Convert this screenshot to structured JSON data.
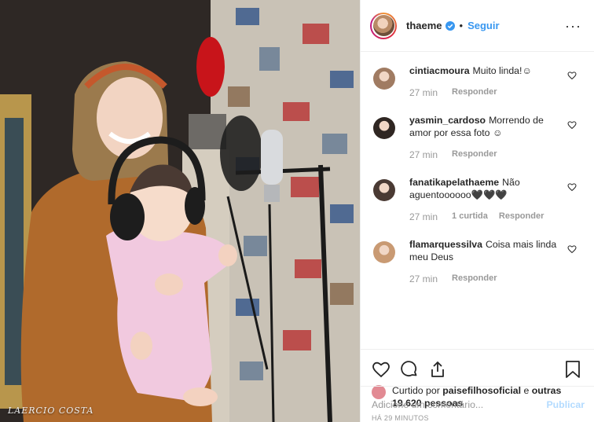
{
  "photo": {
    "watermark": "LAERCIO COSTA"
  },
  "header": {
    "username": "thaeme",
    "verified_icon": "verified-badge-icon",
    "separator": "•",
    "follow_label": "Seguir",
    "more_icon": "more-options-icon",
    "more_glyph": "···"
  },
  "comments": [
    {
      "user": "cintiacmoura",
      "text": "Muito linda!☺",
      "time": "27 min",
      "actions": [
        "Responder"
      ],
      "avatar_color": "#a07b62"
    },
    {
      "user": "yasmin_cardoso",
      "text": "Morrendo de amor por essa foto ☺",
      "time": "27 min",
      "actions": [
        "Responder"
      ],
      "avatar_color": "#2f2622"
    },
    {
      "user": "fanatikapelathaeme",
      "text": "Não aguentoooooo🖤🖤🖤",
      "time": "27 min",
      "actions": [
        "1 curtida",
        "Responder"
      ],
      "avatar_color": "#4a3a33"
    },
    {
      "user": "flamarquessilva",
      "text": "Coisa mais linda meu Deus",
      "time": "27 min",
      "actions": [
        "Responder"
      ],
      "avatar_color": "#c99a73"
    }
  ],
  "actions": {
    "icons": [
      "heart-icon",
      "comment-icon",
      "share-icon",
      "bookmark-icon"
    ],
    "liked_prefix": "Curtido por",
    "liked_user": "paisefilhosoficial",
    "liked_middle": "e",
    "liked_others": "outras 19.620 pessoas",
    "time_ago": "HÁ 29 MINUTOS"
  },
  "add_comment": {
    "placeholder": "Adicione um comentário...",
    "publish_label": "Publicar"
  },
  "colors": {
    "link_blue": "#3897f0",
    "publish_disabled": "#b3dbff",
    "muted_text": "#999999",
    "border": "#efefef"
  }
}
